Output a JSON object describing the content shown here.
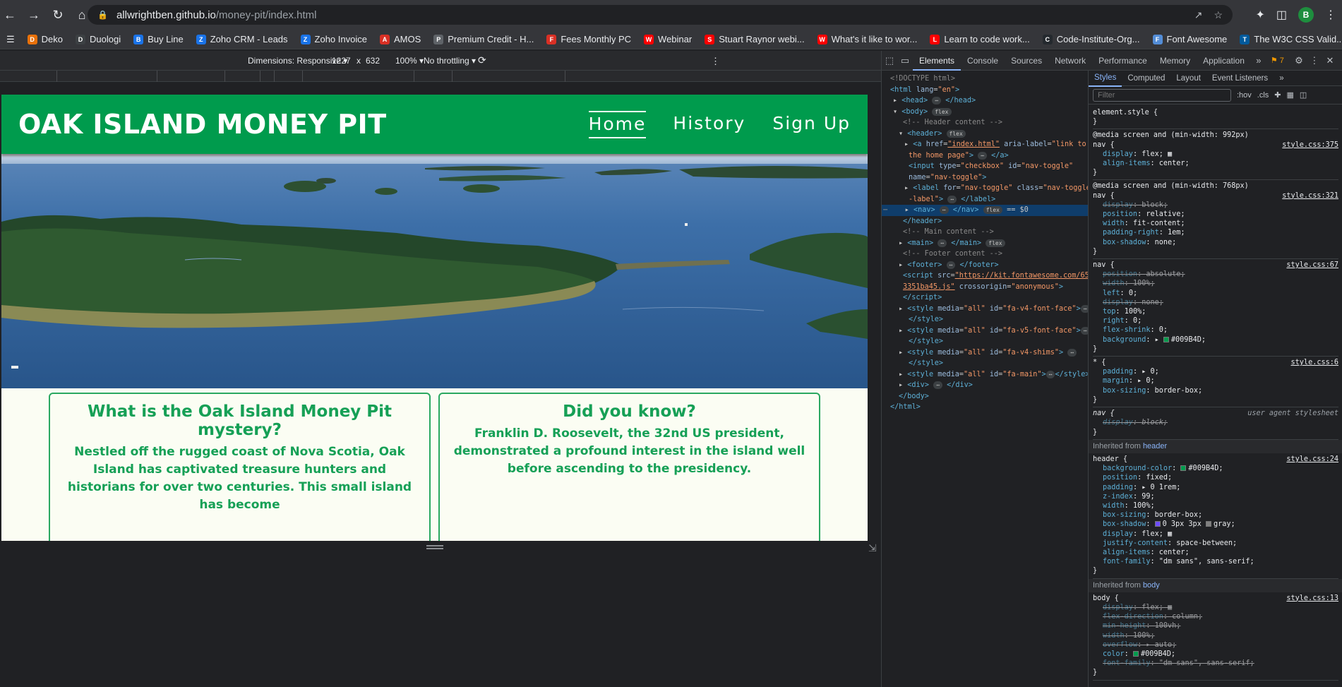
{
  "browser": {
    "url_host": "allwrightben.github.io",
    "url_path": "/money-pit/index.html",
    "profile_initial": "B",
    "bookmarks": [
      {
        "label": "Deko",
        "color": "#e8710a"
      },
      {
        "label": "Duologi",
        "color": "#3c4043"
      },
      {
        "label": "Buy Line",
        "color": "#1a73e8"
      },
      {
        "label": "Zoho CRM - Leads",
        "color": "#1a73e8"
      },
      {
        "label": "Zoho Invoice",
        "color": "#1a73e8"
      },
      {
        "label": "AMOS",
        "color": "#d93025"
      },
      {
        "label": "Premium Credit - H...",
        "color": "#5f6368"
      },
      {
        "label": "Fees Monthly PC",
        "color": "#d93025"
      },
      {
        "label": "Webinar",
        "color": "#ff0000"
      },
      {
        "label": "Stuart Raynor webi...",
        "color": "#ff0000"
      },
      {
        "label": "What's it like to wor...",
        "color": "#ff0000"
      },
      {
        "label": "Learn to code work...",
        "color": "#ff0000"
      },
      {
        "label": "Code-Institute-Org...",
        "color": "#24292e"
      },
      {
        "label": "Font Awesome",
        "color": "#538dd7"
      },
      {
        "label": "The W3C CSS Valid...",
        "color": "#005a9c"
      }
    ]
  },
  "device_toolbar": {
    "dimensions": "Dimensions: Responsive ▾",
    "width": "1227",
    "x": "x",
    "height": "632",
    "zoom": "100% ▾",
    "throttling": "No throttling ▾"
  },
  "site": {
    "title": "OAK ISLAND MONEY PIT",
    "nav": [
      "Home",
      "History",
      "Sign Up"
    ],
    "card1_title": "What is the Oak Island Money Pit mystery?",
    "card1_text": "Nestled off the rugged coast of Nova Scotia, Oak Island has captivated treasure hunters and historians for over two centuries. This small island has become",
    "card2_title": "Did you know?",
    "card2_text": "Franklin D. Roosevelt, the 32nd US president, demonstrated a profound interest in the island well before ascending to the presidency.",
    "colors": {
      "brand": "#009B4D",
      "background": "#fbfdf3"
    }
  },
  "devtools": {
    "tabs": [
      "Elements",
      "Console",
      "Sources",
      "Network",
      "Performance",
      "Memory",
      "Application"
    ],
    "issues_count": "7",
    "sub_tabs": [
      "Styles",
      "Computed",
      "Layout",
      "Event Listeners"
    ],
    "filter_placeholder": "Filter",
    "hov": ":hov",
    "cls": ".cls",
    "inherited_label": "Inherited from",
    "inherited_header": "header",
    "inherited_body": "body"
  }
}
